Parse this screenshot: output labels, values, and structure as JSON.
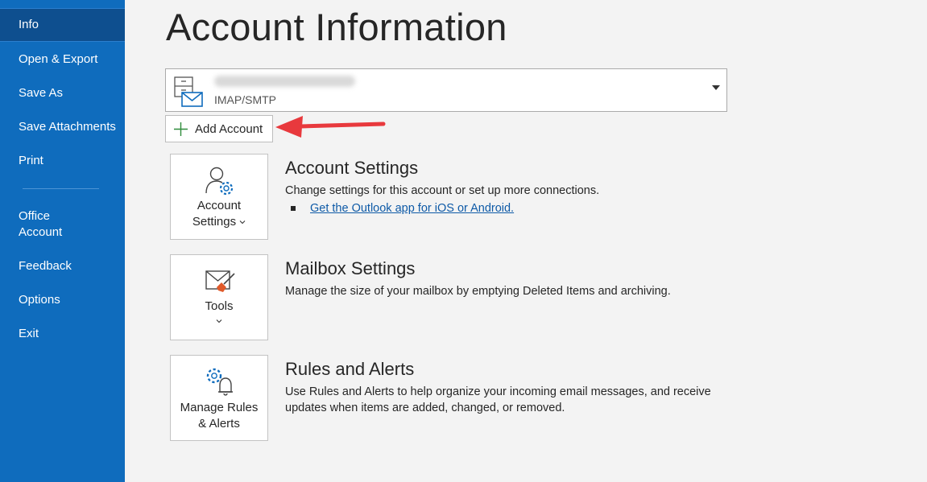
{
  "sidebar": {
    "items": [
      {
        "label": "Info",
        "active": true
      },
      {
        "label": "Open & Export"
      },
      {
        "label": "Save As"
      },
      {
        "label": "Save Attachments"
      },
      {
        "label": "Print"
      },
      {
        "label": "Office\nAccount"
      },
      {
        "label": "Feedback"
      },
      {
        "label": "Options"
      },
      {
        "label": "Exit"
      }
    ]
  },
  "main": {
    "title": "Account Information",
    "account": {
      "email": "",
      "type": "IMAP/SMTP",
      "icon": "account-mail-icon"
    },
    "add_account_label": "Add Account",
    "sections": [
      {
        "tile_label_1": "Account",
        "tile_label_2": "Settings",
        "title": "Account Settings",
        "description": "Change settings for this account or set up more connections.",
        "link": "Get the Outlook app for iOS or Android.",
        "icon": "account-settings-icon"
      },
      {
        "tile_label_1": "Tools",
        "title": "Mailbox Settings",
        "description": "Manage the size of your mailbox by emptying Deleted Items and archiving.",
        "icon": "mailbox-tools-icon"
      },
      {
        "tile_label_1": "Manage Rules",
        "tile_label_2": "& Alerts",
        "title": "Rules and Alerts",
        "description_1": "Use Rules and Alerts to help organize your incoming email messages, and receive",
        "description_2": "updates when items are added, changed, or removed.",
        "icon": "rules-alerts-icon"
      }
    ]
  },
  "colors": {
    "sidebar": "#0f6cbd",
    "sidebar_active": "#0e4f8f",
    "annotation_arrow": "#e8393d",
    "link": "#0e5aa7"
  }
}
